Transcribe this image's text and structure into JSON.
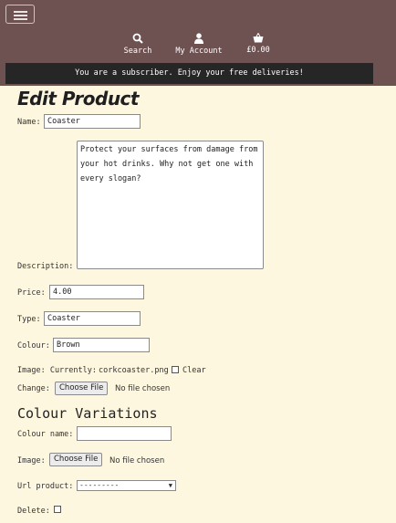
{
  "header": {
    "nav": [
      {
        "label": "Search",
        "icon": "search-icon"
      },
      {
        "label": "My Account",
        "icon": "user-icon"
      },
      {
        "label": "£0.00",
        "icon": "basket-icon"
      }
    ],
    "banner": "You are a subscriber. Enjoy your free deliveries!",
    "colors": {
      "header_bg": "#6e5252",
      "banner_bg": "#262626",
      "page_bg": "#fdf7e0"
    }
  },
  "form": {
    "title": "Edit Product",
    "name_label": "Name:",
    "name_value": "Coaster",
    "description_label": "Description:",
    "description_value": "Protect your surfaces from damage from your hot drinks. Why not get one with every slogan?",
    "price_label": "Price:",
    "price_value": "4.00",
    "type_label": "Type:",
    "type_value": "Coaster",
    "colour_label": "Colour:",
    "colour_value": "Brown",
    "image_label": "Image: Currently:",
    "image_current": "corkcoaster.png",
    "clear_label": "Clear",
    "change_label": "Change:",
    "choose_file": "Choose File",
    "no_file": "No file chosen"
  },
  "variations": {
    "title": "Colour Variations",
    "colour_name_label": "Colour name:",
    "colour_name_value": "",
    "image_label": "Image:",
    "choose_file": "Choose File",
    "no_file": "No file chosen",
    "url_product_label": "Url product:",
    "url_product_selected": "---------",
    "delete_label": "Delete:"
  }
}
